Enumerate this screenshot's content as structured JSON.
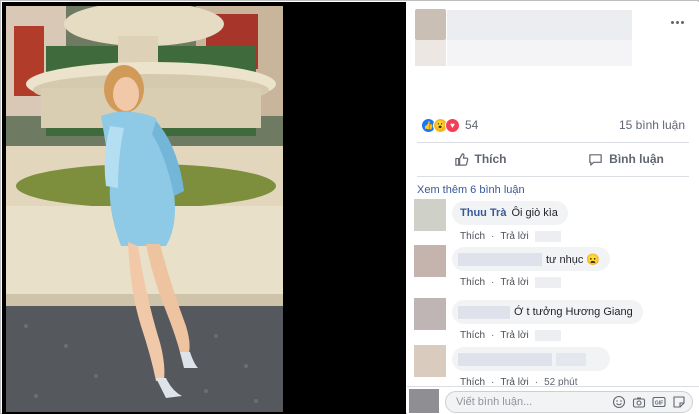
{
  "post": {
    "reaction_count": "54",
    "comment_count_label": "15 bình luận",
    "reactions": [
      "like-icon",
      "wow-icon",
      "love-icon"
    ]
  },
  "actions": {
    "like_label": "Thích",
    "comment_label": "Bình luận"
  },
  "comments": {
    "view_more_label": "Xem thêm 6 bình luận",
    "items": [
      {
        "author": "Thuu Trà",
        "text": "Ôi giò kìa",
        "like": "Thích",
        "reply": "Trả lời",
        "time": ""
      },
      {
        "author": "",
        "text": "tư nhục 😦",
        "like": "Thích",
        "reply": "Trả lời",
        "time": ""
      },
      {
        "author": "",
        "text": "Ớ t tưởng Hương Giang",
        "like": "Thích",
        "reply": "Trả lời",
        "time": ""
      },
      {
        "author": "",
        "text": "",
        "like": "Thích",
        "reply": "Trả lời",
        "time": "52 phút"
      }
    ]
  },
  "composer": {
    "placeholder": "Viết bình luận..."
  },
  "colors": {
    "link": "#385898",
    "like_blue": "#1877f2",
    "love_red": "#f33e58",
    "wow_yellow": "#f7b928",
    "bubble_bg": "#f2f3f5"
  }
}
